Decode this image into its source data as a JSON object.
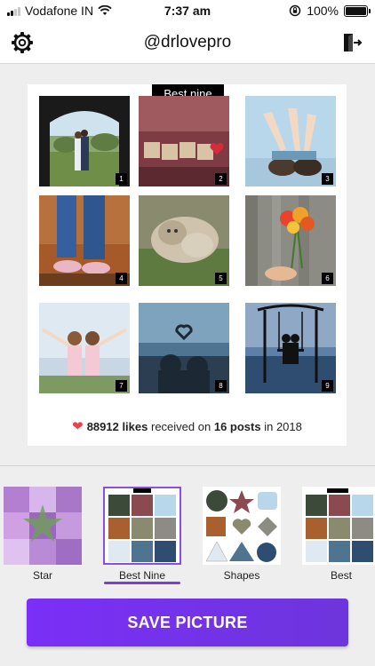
{
  "status_bar": {
    "carrier": "Vodafone IN",
    "time": "7:37 am",
    "battery": "100%"
  },
  "header": {
    "title": "@drlovepro"
  },
  "preview": {
    "tag": "Best nine",
    "tiles": [
      {
        "num": "1",
        "theme": "couple-doorway"
      },
      {
        "num": "2",
        "theme": "love-blocks"
      },
      {
        "num": "3",
        "theme": "legs-up"
      },
      {
        "num": "4",
        "theme": "sneakers-rust"
      },
      {
        "num": "5",
        "theme": "cats"
      },
      {
        "num": "6",
        "theme": "flowers-hand"
      },
      {
        "num": "7",
        "theme": "girls-cheer"
      },
      {
        "num": "8",
        "theme": "heart-hands"
      },
      {
        "num": "9",
        "theme": "swing-sea"
      }
    ],
    "stats": {
      "likes": "88912 likes",
      "middle": "received on",
      "posts": "16 posts",
      "suffix": "in 2018"
    }
  },
  "templates": [
    {
      "label": "Star",
      "selected": false
    },
    {
      "label": "Best Nine",
      "selected": true
    },
    {
      "label": "Shapes",
      "selected": false
    },
    {
      "label": "Best",
      "selected": false
    }
  ],
  "save_button": {
    "label": "SAVE PICTURE"
  },
  "colors": {
    "accent": "#7b2ff7",
    "heart": "#e8434a"
  }
}
